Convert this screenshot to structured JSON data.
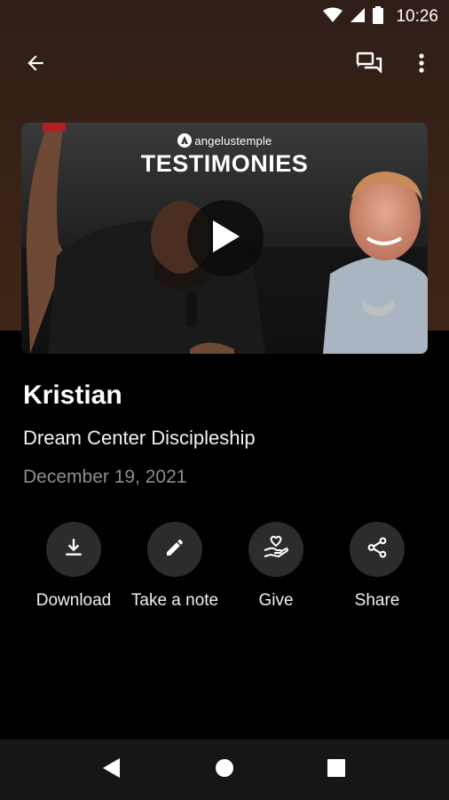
{
  "status_bar": {
    "time": "10:26"
  },
  "app_bar": {
    "back_icon": "arrow-back-icon",
    "chat_icon": "chat-icon",
    "menu_icon": "more-vert-icon"
  },
  "media": {
    "brand": "angelustemple",
    "title": "TESTIMONIES",
    "play_icon": "play-icon"
  },
  "content": {
    "title": "Kristian",
    "subtitle": "Dream Center Discipleship",
    "date": "December 19, 2021"
  },
  "actions": [
    {
      "label": "Download",
      "icon": "download-icon"
    },
    {
      "label": "Take a note",
      "icon": "pencil-icon"
    },
    {
      "label": "Give",
      "icon": "give-heart-hand-icon"
    },
    {
      "label": "Share",
      "icon": "share-icon"
    }
  ],
  "nav_bar": {
    "back": "nav-back-icon",
    "home": "nav-home-icon",
    "recents": "nav-recents-icon"
  },
  "colors": {
    "background": "#000000",
    "header_bg": "#3a2216",
    "action_circle": "#2c2c2e",
    "date_text": "#8d8d8d"
  }
}
